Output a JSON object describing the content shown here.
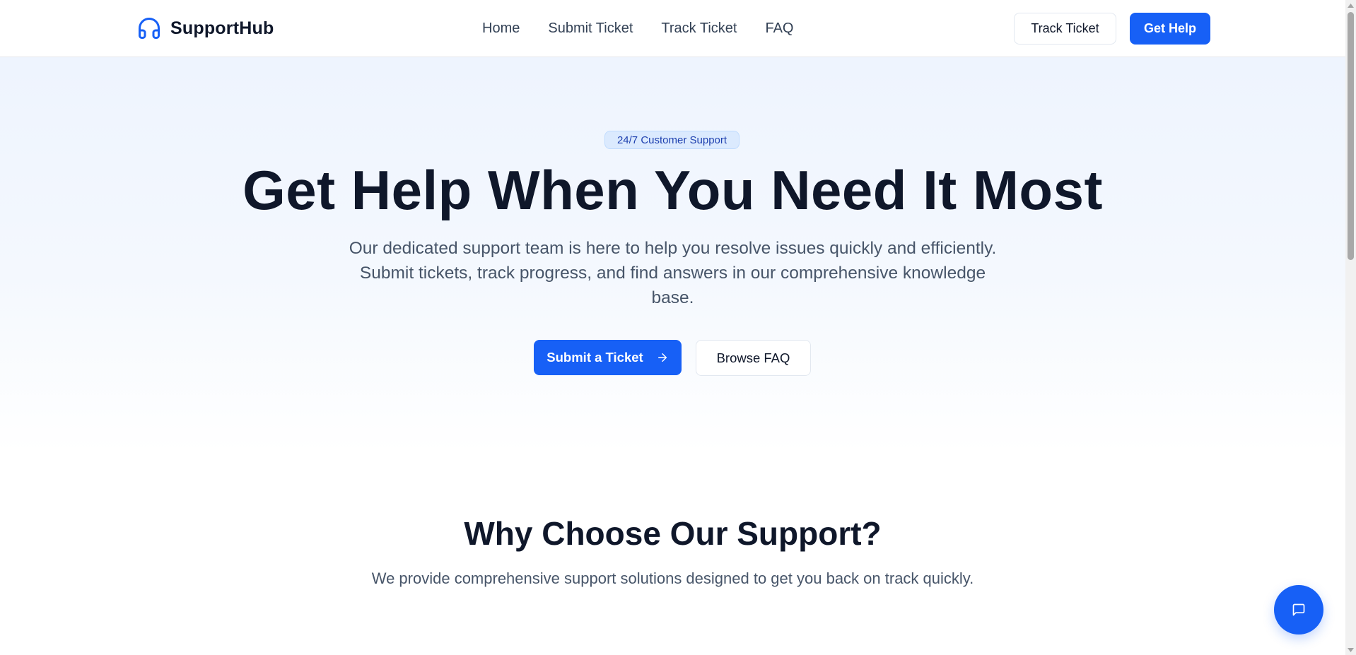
{
  "brand": {
    "name": "SupportHub",
    "accent_color": "#1760f6",
    "logo_icon": "headphones-icon"
  },
  "nav": {
    "items": [
      {
        "label": "Home"
      },
      {
        "label": "Submit Ticket"
      },
      {
        "label": "Track Ticket"
      },
      {
        "label": "FAQ"
      }
    ]
  },
  "header_actions": {
    "track_label": "Track Ticket",
    "help_label": "Get Help"
  },
  "hero": {
    "badge": "24/7 Customer Support",
    "title": "Get Help When You Need It Most",
    "subtitle": "Our dedicated support team is here to help you resolve issues quickly and efficiently. Submit tickets, track progress, and find answers in our comprehensive knowledge base.",
    "primary_cta": "Submit a Ticket",
    "primary_cta_icon": "arrow-right-icon",
    "secondary_cta": "Browse FAQ"
  },
  "features": {
    "title": "Why Choose Our Support?",
    "subtitle": "We provide comprehensive support solutions designed to get you back on track quickly."
  },
  "chat_widget": {
    "icon": "chat-bubble-icon"
  }
}
